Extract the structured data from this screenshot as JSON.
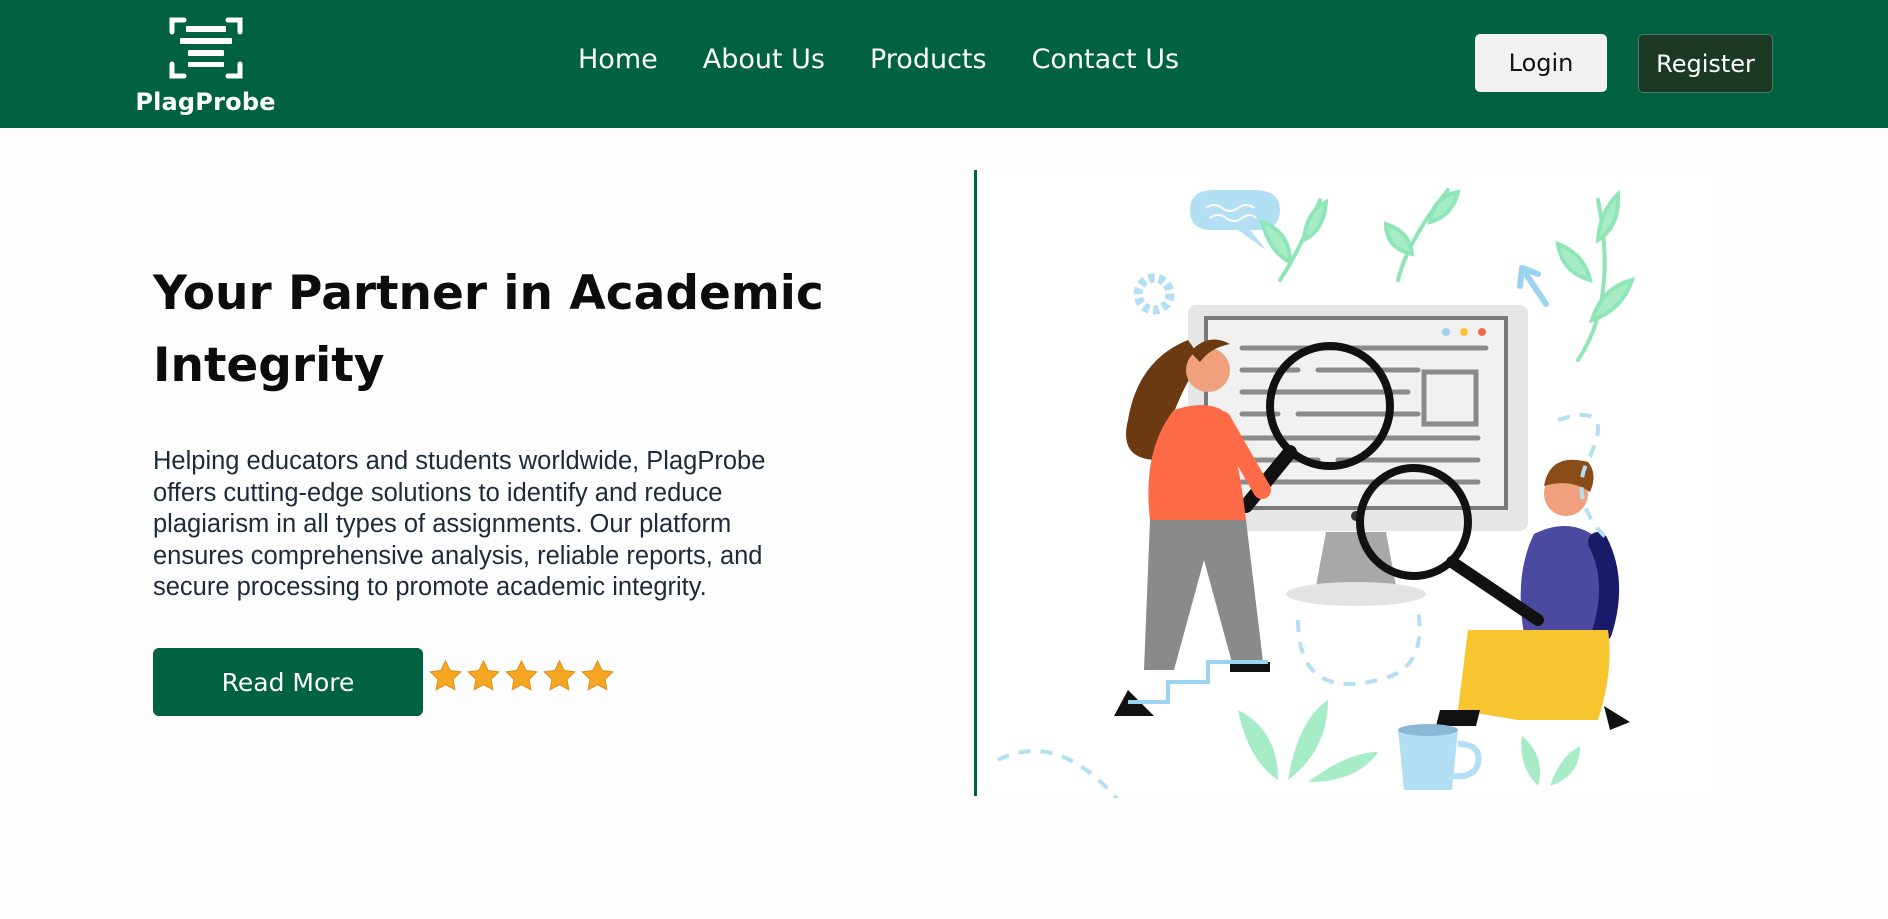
{
  "brand": {
    "name": "PlagProbe",
    "logo_icon": "document-scan-icon"
  },
  "nav": {
    "items": [
      {
        "label": "Home"
      },
      {
        "label": "About Us"
      },
      {
        "label": "Products"
      },
      {
        "label": "Contact Us"
      }
    ],
    "login_label": "Login",
    "register_label": "Register"
  },
  "hero": {
    "title": "Your Partner in Academic Integrity",
    "description": "Helping educators and students worldwide, PlagProbe offers cutting-edge solutions to identify and reduce plagiarism in all types of assignments. Our platform ensures comprehensive analysis, reliable reports, and secure processing to promote academic integrity.",
    "cta_label": "Read More",
    "rating": 5,
    "rating_max": 5,
    "illustration": "people-inspecting-monitor-with-magnifiers"
  },
  "colors": {
    "brand_green": "#006241",
    "register_bg": "#1b3a26",
    "star": "#f5a623"
  }
}
